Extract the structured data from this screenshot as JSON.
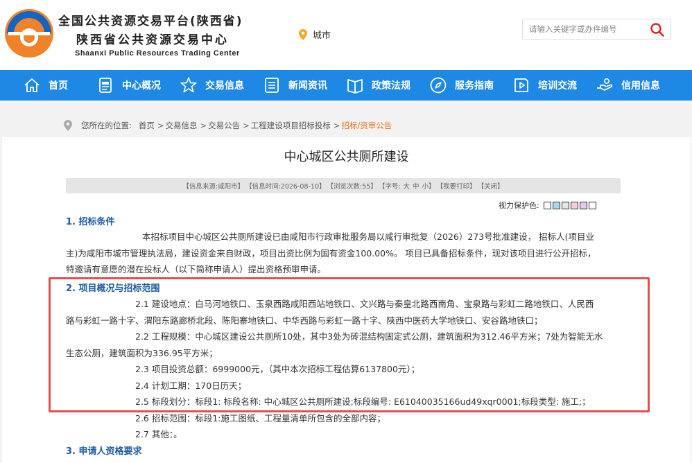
{
  "header": {
    "title_line1": "全国公共资源交易平台(陕西省)",
    "title_line2": "陕西省公共资源交易中心",
    "title_line3": "Shaanxi Public Resources Trading Center",
    "city_label": "城市",
    "search_placeholder": "请输入关键字或办件编号",
    "brand_orange": "#f0832a",
    "brand_blue": "#1565c0"
  },
  "nav": {
    "background": "#1e88e5",
    "items": [
      {
        "label": "首页",
        "icon": "home-icon"
      },
      {
        "label": "中心概况",
        "icon": "document-icon"
      },
      {
        "label": "交易信息",
        "icon": "star-icon"
      },
      {
        "label": "新闻资讯",
        "icon": "list-icon"
      },
      {
        "label": "政策法规",
        "icon": "book-icon"
      },
      {
        "label": "服务指南",
        "icon": "compass-icon"
      },
      {
        "label": "培训交流",
        "icon": "video-icon"
      },
      {
        "label": "信用信息",
        "icon": "hand-icon"
      }
    ]
  },
  "breadcrumb": {
    "prefix": "您所在的位置:",
    "items": [
      "首页",
      "交易信息",
      "交易公告",
      "工程建设项目招标投标"
    ],
    "separator": ">",
    "current": "招标/资审公告",
    "current_color": "#e8731c"
  },
  "article": {
    "title": "中心城区公共厕所建设",
    "info": {
      "source": "【信息来源:咸阳市】",
      "time": "【信息时间:2026-08-10】",
      "views": "【浏览次数:55】",
      "font_size_label": "【字号:",
      "font_large": "大",
      "font_medium": "中",
      "font_small": "小】",
      "print": "【我要打印】",
      "close": "【关闭】"
    },
    "eye_protect": {
      "label": "视力保护色:",
      "colors": [
        "#ffffff",
        "#a8d8f0",
        "#e6e6e6",
        "#f5d0d8",
        "#e6c8f0",
        "#ffffff"
      ]
    },
    "section1": {
      "heading": "1. 招标条件",
      "line1": "本招标项目中心城区公共厕所建设已由咸阳市行政审批服务局以咸行审批复（2026）273号批准建设， 招标人(项目业",
      "line2": "主)为咸阳市城市管理执法局，建设资金来自财政，项目出资比例为国有资金100.00%。 项目已具备招标条件，现对该项目进行公开招标，",
      "line3": "特邀请有意愿的潜在投标人（以下简称申请人）提出资格预审申请。"
    },
    "section2": {
      "heading": "2. 项目概况与招标范围",
      "p1_line1": "2.1 建设地点：白马河地铁口、玉泉西路咸阳西站地铁口、文兴路与秦皇北路西南角、宝泉路与彩虹二路地铁口、人民西",
      "p1_line2": "路与彩虹一路十字、渭阳东路廊桥北段、陈阳寨地铁口、中华西路与彩虹一路十字、陕西中医药大学地铁口、安谷路地铁口；",
      "p2_line1": "2.2 工程规模：中心城区建设公共厕所10处，其中3处为砖混结构固定式公厕，建筑面积为312.46平方米；7处为智能无水",
      "p2_line2": "生态公厕，建筑面积为336.95平方米；",
      "p3": "2.3 项目投资总额：6999000元，（其中本次招标工程估算6137800元）；",
      "p4": "2.4 计划工期：170日历天；",
      "p5": "2.5 标段划分：标段1: 标段名称: 中心城区公共厕所建设;标段编号: E61040035166ud49xqr0001;标段类型: 施工;；",
      "p6": "2.6 招标范围：标段1:施工图纸、工程量清单所包含的全部内容；",
      "p7": "2.7 其他：。"
    },
    "section3": {
      "heading": "3. 申请人资格要求"
    },
    "highlight_color": "#e0504d"
  }
}
